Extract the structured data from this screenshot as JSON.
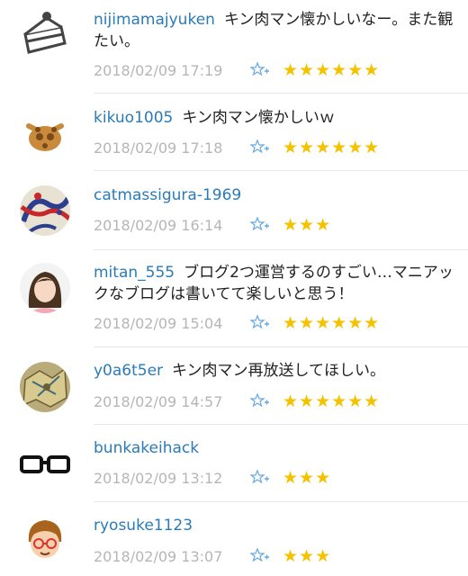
{
  "comments": [
    {
      "user": "nijimamajyuken",
      "text": "キン肉マン懐かしいなー。また観たい。",
      "date": "2018/02/09 17:19",
      "stars": "★★★★★★",
      "avatar": "cake-icon"
    },
    {
      "user": "kikuo1005",
      "text": "キン肉マン懐かしいｗ",
      "date": "2018/02/09 17:18",
      "stars": "★★★★★★",
      "avatar": "giraffe-icon"
    },
    {
      "user": "catmassigura-1969",
      "text": "",
      "date": "2018/02/09 16:14",
      "stars": "★★★",
      "avatar": "pattern-icon"
    },
    {
      "user": "mitan_555",
      "text": "ブログ2つ運営するのすごい…マニアックなブログは書いてて楽しいと思う！",
      "date": "2018/02/09 15:04",
      "stars": "★★★★★★",
      "avatar": "woman-icon"
    },
    {
      "user": "y0a6t5er",
      "text": "キン肉マン再放送してほしい。",
      "date": "2018/02/09 14:57",
      "stars": "★★★★★★",
      "avatar": "map-icon"
    },
    {
      "user": "bunkakeihack",
      "text": "",
      "date": "2018/02/09 13:12",
      "stars": "★★★",
      "avatar": "glasses-icon"
    },
    {
      "user": "ryosuke1123",
      "text": "",
      "date": "2018/02/09 13:07",
      "stars": "★★★",
      "avatar": "boy-icon"
    }
  ],
  "colors": {
    "username": "#2a7bb8",
    "star": "#f5c200",
    "meta": "#b6b6b6",
    "add_star": "#6aa9e0"
  }
}
